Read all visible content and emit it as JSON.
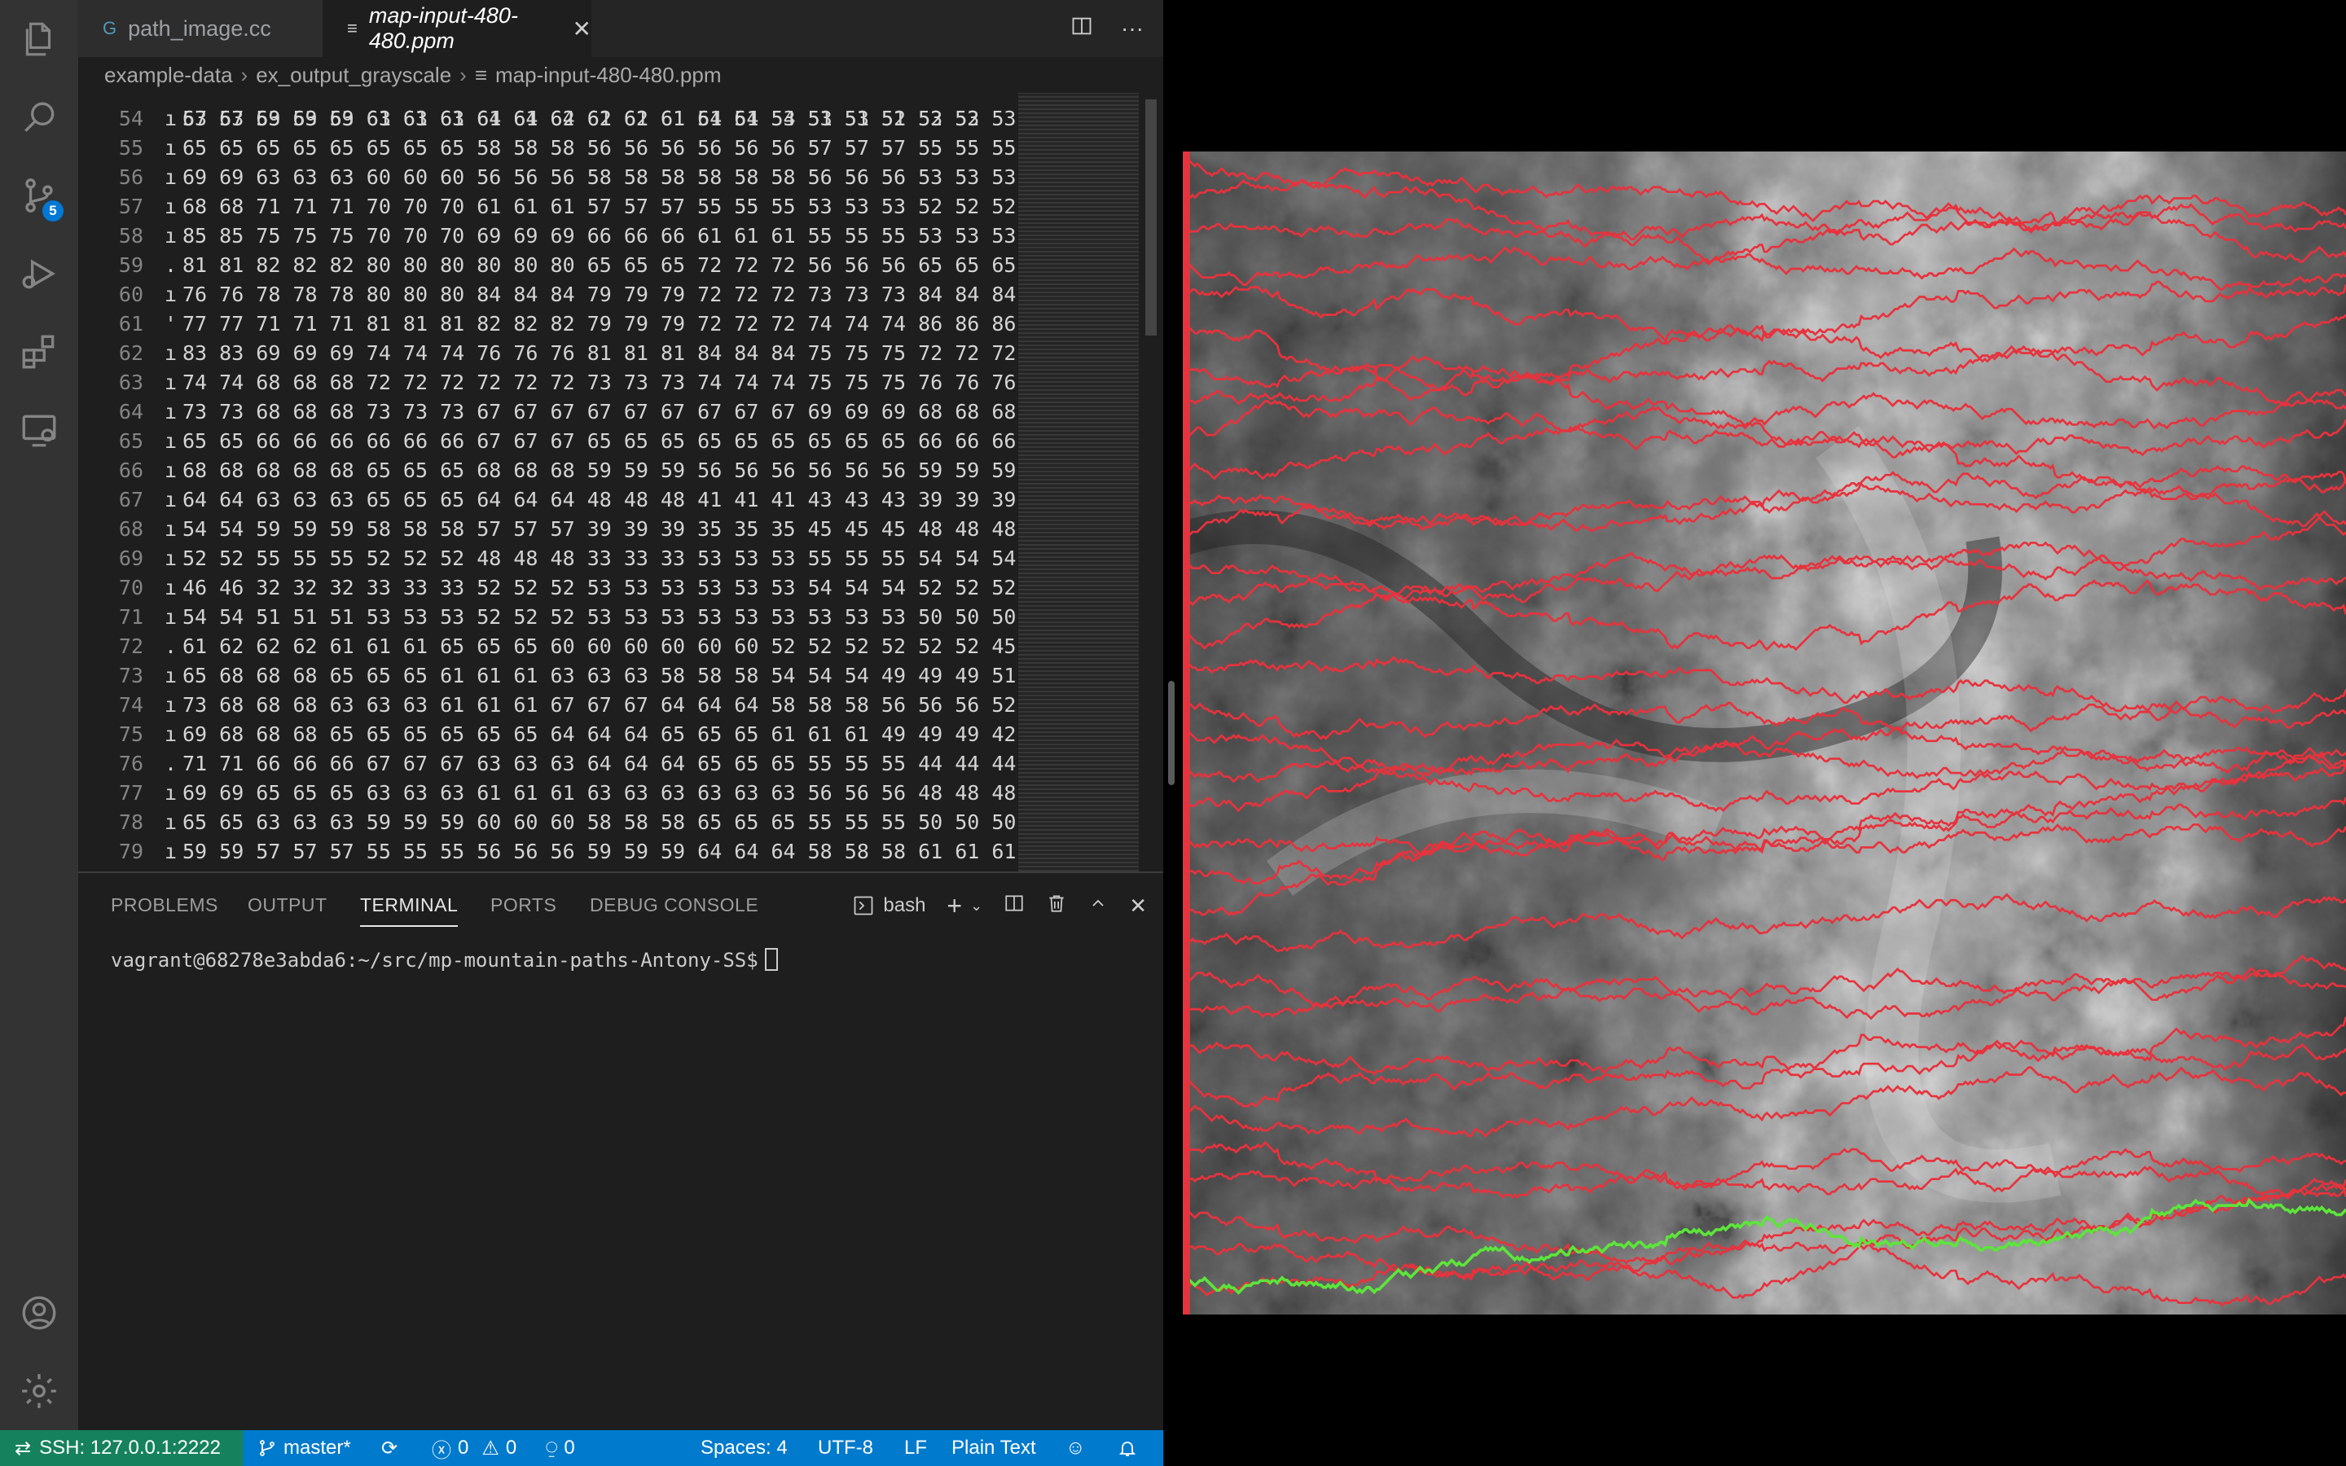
{
  "tabs": [
    {
      "label": "path_image.cc",
      "icon": "G"
    },
    {
      "label": "map-input-480-480.ppm",
      "icon": "≡"
    }
  ],
  "breadcrumb": [
    "example-data",
    "ex_output_grayscale",
    "map-input-480-480.ppm"
  ],
  "scm_badge": "5",
  "editor": {
    "partial_top": "57 57 59 59 59 61 61 61 61 61 62 62 62 61 61 61 53 53 53 52 52 52",
    "lines": [
      {
        "n": "54",
        "m": "ı",
        "t": "63 63 63 63 63 63 63 63 64 64 64 61 61 61 54 54 54 51 51 51 53 53 53"
      },
      {
        "n": "55",
        "m": "ı",
        "t": "65 65 65 65 65 65 65 65 58 58 58 56 56 56 56 56 56 57 57 57 55 55 55"
      },
      {
        "n": "56",
        "m": "ı",
        "t": "69 69 63 63 63 60 60 60 56 56 56 58 58 58 58 58 58 56 56 56 53 53 53"
      },
      {
        "n": "57",
        "m": "ı",
        "t": "68 68 71 71 71 70 70 70 61 61 61 57 57 57 55 55 55 53 53 53 52 52 52"
      },
      {
        "n": "58",
        "m": "ı",
        "t": "85 85 75 75 75 70 70 70 69 69 69 66 66 66 61 61 61 55 55 55 53 53 53"
      },
      {
        "n": "59",
        "m": ".",
        "t": "81 81 82 82 82 80 80 80 80 80 80 65 65 65 72 72 72 56 56 56 65 65 65"
      },
      {
        "n": "60",
        "m": "ı",
        "t": "76 76 78 78 78 80 80 80 84 84 84 79 79 79 72 72 72 73 73 73 84 84 84"
      },
      {
        "n": "61",
        "m": "'",
        "t": "77 77 71 71 71 81 81 81 82 82 82 79 79 79 72 72 72 74 74 74 86 86 86"
      },
      {
        "n": "62",
        "m": "ı",
        "t": "83 83 69 69 69 74 74 74 76 76 76 81 81 81 84 84 84 75 75 75 72 72 72"
      },
      {
        "n": "63",
        "m": "ı",
        "t": "74 74 68 68 68 72 72 72 72 72 72 73 73 73 74 74 74 75 75 75 76 76 76"
      },
      {
        "n": "64",
        "m": "ı",
        "t": "73 73 68 68 68 73 73 73 67 67 67 67 67 67 67 67 67 69 69 69 68 68 68"
      },
      {
        "n": "65",
        "m": "ı",
        "t": "65 65 66 66 66 66 66 66 67 67 67 65 65 65 65 65 65 65 65 65 66 66 66"
      },
      {
        "n": "66",
        "m": "ı",
        "t": "68 68 68 68 68 65 65 65 68 68 68 59 59 59 56 56 56 56 56 56 59 59 59"
      },
      {
        "n": "67",
        "m": "ı",
        "t": "64 64 63 63 63 65 65 65 64 64 64 48 48 48 41 41 41 43 43 43 39 39 39"
      },
      {
        "n": "68",
        "m": "ı",
        "t": "54 54 59 59 59 58 58 58 57 57 57 39 39 39 35 35 35 45 45 45 48 48 48"
      },
      {
        "n": "69",
        "m": "ı",
        "t": "52 52 55 55 55 52 52 52 48 48 48 33 33 33 53 53 53 55 55 55 54 54 54"
      },
      {
        "n": "70",
        "m": "ı",
        "t": "46 46 32 32 32 33 33 33 52 52 52 53 53 53 53 53 53 54 54 54 52 52 52"
      },
      {
        "n": "71",
        "m": "ı",
        "t": "54 54 51 51 51 53 53 53 52 52 52 53 53 53 53 53 53 53 53 53 50 50 50"
      },
      {
        "n": "72",
        "m": ".",
        "t": "61 62 62 62 61 61 61 65 65 65 60 60 60 60 60 60 52 52 52 52 52 52 45"
      },
      {
        "n": "73",
        "m": "ı",
        "t": "65 68 68 68 65 65 65 61 61 61 63 63 63 58 58 58 54 54 54 49 49 49 51"
      },
      {
        "n": "74",
        "m": "ı",
        "t": "73 68 68 68 63 63 63 61 61 61 67 67 67 64 64 64 58 58 58 56 56 56 52"
      },
      {
        "n": "75",
        "m": "ı",
        "t": "69 68 68 68 65 65 65 65 65 65 64 64 64 65 65 65 61 61 61 49 49 49 42"
      },
      {
        "n": "76",
        "m": ".",
        "t": "71 71 66 66 66 67 67 67 63 63 63 64 64 64 65 65 65 55 55 55 44 44 44"
      },
      {
        "n": "77",
        "m": "ı",
        "t": "69 69 65 65 65 63 63 63 61 61 61 63 63 63 63 63 63 56 56 56 48 48 48"
      },
      {
        "n": "78",
        "m": "ı",
        "t": "65 65 63 63 63 59 59 59 60 60 60 58 58 58 65 65 65 55 55 55 50 50 50"
      },
      {
        "n": "79",
        "m": "ı",
        "t": "59 59 57 57 57 55 55 55 56 56 56 59 59 59 64 64 64 58 58 58 61 61 61"
      }
    ]
  },
  "panel": {
    "tabs": [
      "PROBLEMS",
      "OUTPUT",
      "TERMINAL",
      "PORTS",
      "DEBUG CONSOLE"
    ],
    "active_tab": "TERMINAL",
    "shell": "bash",
    "prompt": "vagrant@68278e3abda6:~/src/mp-mountain-paths-Antony-SS$"
  },
  "status": {
    "remote": "SSH: 127.0.0.1:2222",
    "branch": "master*",
    "errors": "0",
    "warnings": "0",
    "ports": "0",
    "spaces": "Spaces: 4",
    "encoding": "UTF-8",
    "eol": "LF",
    "language": "Plain Text"
  },
  "colors": {
    "accent": "#007acc",
    "remote": "#16825d",
    "path_red": "#e8323c",
    "path_green": "#5ce63a"
  },
  "icons": [
    "files-icon",
    "search-icon",
    "source-control-icon",
    "run-debug-icon",
    "extensions-icon",
    "remote-explorer-icon",
    "account-icon",
    "settings-gear-icon"
  ]
}
